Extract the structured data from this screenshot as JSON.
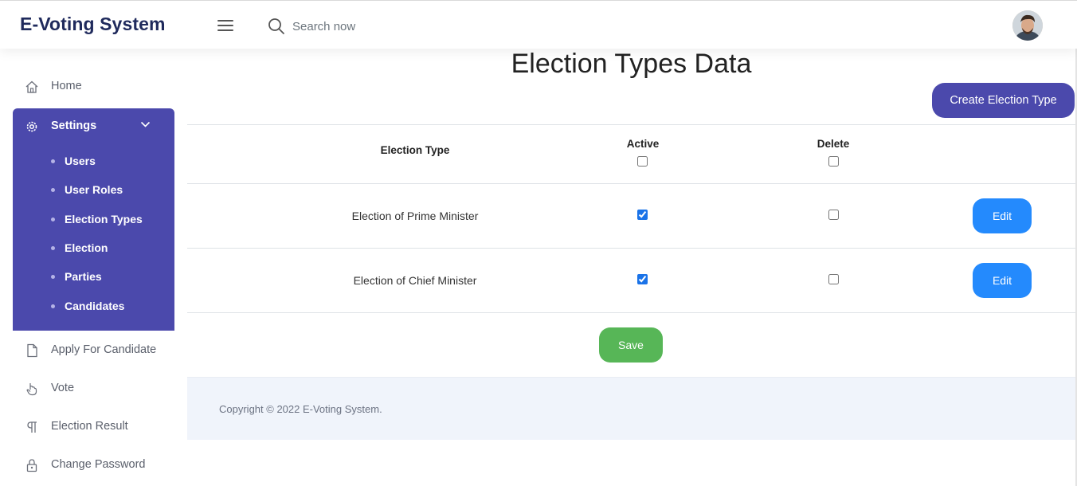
{
  "header": {
    "brand": "E-Voting System",
    "search_placeholder": "Search now"
  },
  "sidebar": {
    "home": "Home",
    "settings": {
      "label": "Settings",
      "items": [
        "Users",
        "User Roles",
        "Election Types",
        "Election",
        "Parties",
        "Candidates"
      ]
    },
    "apply_for_candidate": "Apply For Candidate",
    "vote": "Vote",
    "election_result": "Election Result",
    "change_password": "Change Password"
  },
  "main": {
    "title": "Election Types Data",
    "create_button": "Create Election Type",
    "table": {
      "columns": [
        "Election Type",
        "Active",
        "Delete"
      ],
      "header_active_checked": false,
      "header_delete_checked": false,
      "rows": [
        {
          "name": "Election of Prime Minister",
          "active": true,
          "delete": false,
          "edit": "Edit"
        },
        {
          "name": "Election of Chief Minister",
          "active": true,
          "delete": false,
          "edit": "Edit"
        }
      ]
    },
    "save_button": "Save"
  },
  "footer": {
    "copyright": "Copyright © 2022 E-Voting System."
  },
  "colors": {
    "primary": "#4b49ac",
    "edit": "#248afd",
    "save": "#57b657",
    "footer_bg": "#f0f4fb"
  }
}
